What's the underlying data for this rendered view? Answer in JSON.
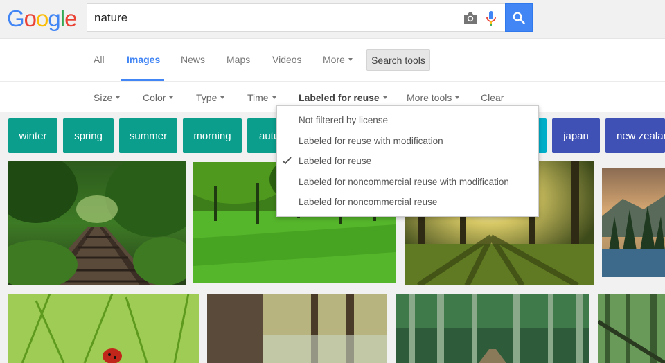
{
  "logo": {
    "letters": [
      "G",
      "o",
      "o",
      "g",
      "l",
      "e"
    ],
    "colors": [
      "#4285f4",
      "#ea4335",
      "#fbbc05",
      "#4285f4",
      "#34a853",
      "#ea4335"
    ]
  },
  "search": {
    "query": "nature"
  },
  "icons": {
    "camera": "camera-icon",
    "mic": "mic-icon",
    "search": "search-icon",
    "check": "check-icon"
  },
  "tabs": [
    {
      "label": "All",
      "active": false
    },
    {
      "label": "Images",
      "active": true
    },
    {
      "label": "News",
      "active": false
    },
    {
      "label": "Maps",
      "active": false
    },
    {
      "label": "Videos",
      "active": false
    },
    {
      "label": "More",
      "active": false
    }
  ],
  "search_tools_label": "Search tools",
  "tools": [
    {
      "label": "Size"
    },
    {
      "label": "Color"
    },
    {
      "label": "Type"
    },
    {
      "label": "Time"
    },
    {
      "label": "Labeled for reuse"
    },
    {
      "label": "More tools"
    },
    {
      "label": "Clear"
    }
  ],
  "chips": [
    {
      "label": "winter",
      "color": "#0b9e8c"
    },
    {
      "label": "spring",
      "color": "#0b9e8c"
    },
    {
      "label": "summer",
      "color": "#0b9e8c"
    },
    {
      "label": "morning",
      "color": "#0b9e8c"
    },
    {
      "label": "autumn",
      "color": "#0b9e8c"
    },
    {
      "label": "",
      "color": "#00aec9"
    },
    {
      "label": "japan",
      "color": "#3f51b5"
    },
    {
      "label": "new zealand",
      "color": "#3f51b5"
    }
  ],
  "license_menu": {
    "items": [
      {
        "label": "Not filtered by license",
        "selected": false
      },
      {
        "label": "Labeled for reuse with modification",
        "selected": false
      },
      {
        "label": "Labeled for reuse",
        "selected": true
      },
      {
        "label": "Labeled for noncommercial reuse with modification",
        "selected": false
      },
      {
        "label": "Labeled for noncommercial reuse",
        "selected": false
      }
    ]
  },
  "colors": {
    "accent": "#4285f4",
    "chip_teal": "#0b9e8c",
    "chip_indigo": "#3f51b5",
    "chip_cyan": "#00aec9"
  }
}
